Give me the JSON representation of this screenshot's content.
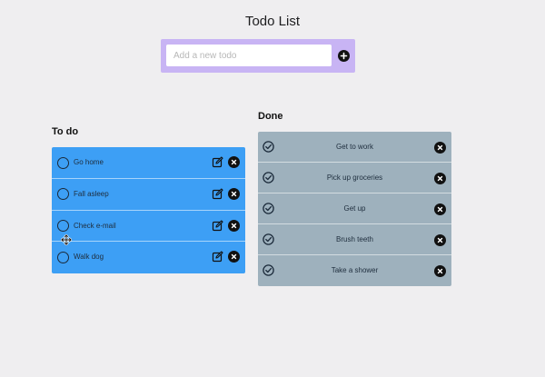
{
  "app": {
    "title": "Todo List"
  },
  "add": {
    "placeholder": "Add a new todo",
    "value": ""
  },
  "todo": {
    "heading": "To do",
    "items": [
      {
        "label": "Go home"
      },
      {
        "label": "Fall asleep"
      },
      {
        "label": "Check e-mail"
      },
      {
        "label": "Walk dog"
      }
    ]
  },
  "done": {
    "heading": "Done",
    "items": [
      {
        "label": "Get to work"
      },
      {
        "label": "Pick up groceries"
      },
      {
        "label": "Get up"
      },
      {
        "label": "Brush teeth"
      },
      {
        "label": "Take a shower"
      }
    ]
  },
  "colors": {
    "background": "#efeef0",
    "add_bar": "#c8b4f4",
    "todo_list": "#3d9ff5",
    "done_list": "#9eb1bd",
    "icon_dark": "#111111"
  },
  "icons": {
    "add": "plus-circle-icon",
    "todo_status": "circle-outline-icon",
    "done_status": "check-circle-icon",
    "edit": "pencil-square-icon",
    "delete": "x-circle-icon",
    "cursor": "move-cursor-icon"
  }
}
